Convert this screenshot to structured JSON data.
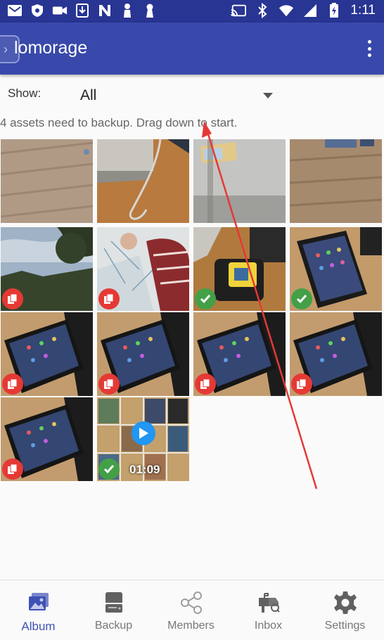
{
  "status_bar": {
    "time": "1:11",
    "left_icons": [
      "mail-icon",
      "shield-icon",
      "video-camera-icon",
      "download-box-icon",
      "n-logo-icon",
      "figure-icon",
      "keyhole-icon"
    ],
    "right_icons": [
      "cast-icon",
      "bluetooth-icon",
      "wifi-icon",
      "signal-icon",
      "battery-icon"
    ]
  },
  "app_bar": {
    "title": "lomorage",
    "menu_icon": "more-vert-icon"
  },
  "filter": {
    "label": "Show:",
    "selected": "All"
  },
  "hint": "4 assets need to backup. Drag down to start.",
  "colors": {
    "status_bar": "#283593",
    "app_bar": "#3949ab",
    "accent": "#3f51b5",
    "badge_red": "#e53935",
    "badge_green": "#43a047",
    "arrow": "#e53935"
  },
  "photos": [
    {
      "name": "photo-floor-1",
      "badge": "none"
    },
    {
      "name": "photo-cable",
      "badge": "none"
    },
    {
      "name": "photo-wall",
      "badge": "none"
    },
    {
      "name": "photo-floor-2",
      "badge": "none"
    },
    {
      "name": "photo-sky-trees",
      "badge": "not-backed-up"
    },
    {
      "name": "photo-drawing",
      "badge": "not-backed-up"
    },
    {
      "name": "photo-device-desk",
      "badge": "backed-up"
    },
    {
      "name": "photo-phone-1",
      "badge": "backed-up"
    },
    {
      "name": "photo-phone-2",
      "badge": "not-backed-up"
    },
    {
      "name": "photo-phone-3",
      "badge": "not-backed-up"
    },
    {
      "name": "photo-phone-4",
      "badge": "not-backed-up"
    },
    {
      "name": "photo-phone-5",
      "badge": "not-backed-up"
    },
    {
      "name": "photo-phone-6",
      "badge": "not-backed-up"
    },
    {
      "name": "video-collage",
      "badge": "backed-up",
      "duration": "01:09"
    }
  ],
  "bottom_nav": [
    {
      "label": "Album",
      "icon": "album-icon",
      "active": true
    },
    {
      "label": "Backup",
      "icon": "backup-drive-icon",
      "active": false
    },
    {
      "label": "Members",
      "icon": "share-icon",
      "active": false
    },
    {
      "label": "Inbox",
      "icon": "inbox-icon",
      "active": false
    },
    {
      "label": "Settings",
      "icon": "gear-icon",
      "active": false
    }
  ]
}
